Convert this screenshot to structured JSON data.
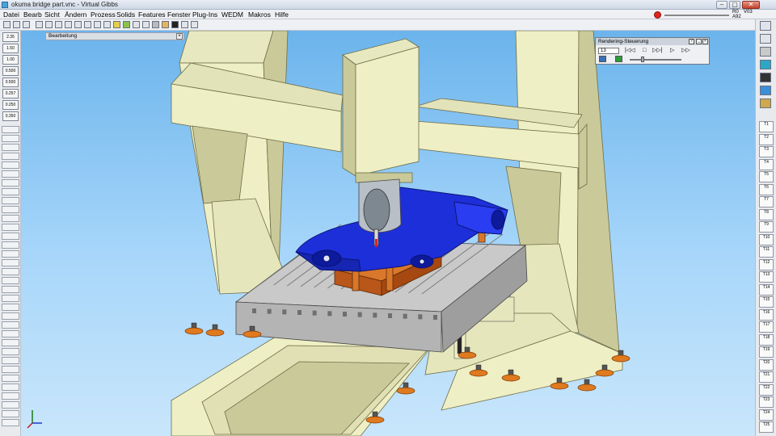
{
  "window": {
    "title": "okuma bridge part.vnc - Virtual Gibbs",
    "buttons": [
      "–",
      "▢",
      "✕"
    ]
  },
  "menu": [
    "Datei",
    "Bearb",
    "Sicht",
    "Ändern",
    "Prozess",
    "Solids",
    "Features",
    "Fenster",
    "Plug-Ins",
    "WEDM",
    "Makros",
    "Hilfe"
  ],
  "menu_right": {
    "r1_top": "R0",
    "r1_bottom": "A92",
    "r2": "V03"
  },
  "left_tools": [
    "2.35",
    "1.50",
    "1.00",
    "0.500",
    "0.500",
    "0.257",
    "0.250",
    "0.350"
  ],
  "bearbeitung_label": "Bearbeitung",
  "rendering": {
    "title": "Rendering-Steuerung",
    "step_value": "13",
    "controls": [
      "|◁◁",
      "□",
      "▷▷|",
      "▷",
      "▷▷"
    ]
  },
  "right_tiles": [
    "T1",
    "T2",
    "T3",
    "T4",
    "T5",
    "T6",
    "T7",
    "T8",
    "T9",
    "T10",
    "T11",
    "T12",
    "T13",
    "T14",
    "T15",
    "T16",
    "T17",
    "T18",
    "T19",
    "T20",
    "T21",
    "T22",
    "T23",
    "T24",
    "T25"
  ],
  "colors": {
    "machine": "#efefc5",
    "machine_shade": "#c9c99a",
    "table": "#c3c3c3",
    "part": "#1d2fd8",
    "fixture": "#c9621d",
    "sky_top": "#6bb4ec"
  }
}
